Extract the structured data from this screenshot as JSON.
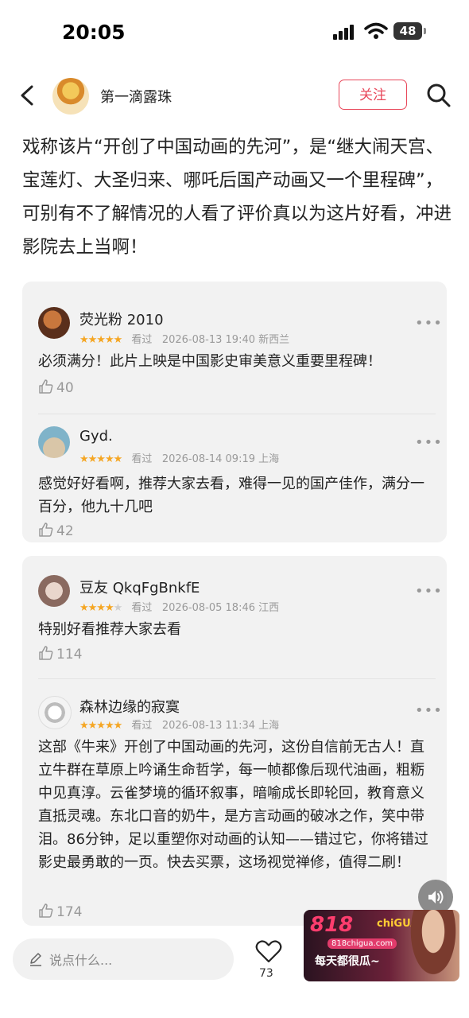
{
  "status": {
    "time": "20:05",
    "battery": "48"
  },
  "nav": {
    "author": "第一滴露珠",
    "follow": "关注"
  },
  "body_text": "戏称该片“开创了中国动画的先河”，是“继大闹天宫、宝莲灯、大圣归来、哪吒后国产动画又一个里程碑”，可别有不了解情况的人看了评价真以为这片好看，冲进影院去上当啊！",
  "comments": [
    {
      "name": "荧光粉 2010",
      "rating": 5,
      "watched": "看过",
      "time": "2026-08-13 19:40 新西兰",
      "text": "必须满分！此片上映是中国影史审美意义重要里程碑！",
      "likes": "40"
    },
    {
      "name": "Gyd.",
      "rating": 5,
      "watched": "看过",
      "time": "2026-08-14 09:19 上海",
      "text": "感觉好好看啊，推荐大家去看，难得一见的国产佳作，满分一百分，他九十几吧",
      "likes": "42"
    },
    {
      "name": "豆友 QkqFgBnkfE",
      "rating": 4,
      "watched": "看过",
      "time": "2026-08-05 18:46 江西",
      "text": "特别好看推荐大家去看",
      "likes": "114"
    },
    {
      "name": "森林边缘的寂寞",
      "rating": 5,
      "watched": "看过",
      "time": "2026-08-13 11:34 上海",
      "text": "这部《牛来》开创了中国动画的先河，这份自信前无古人！直立牛群在草原上吟诵生命哲学，每一帧都像后现代油画，粗粝中见真淳。云雀梦境的循环叙事，暗喻成长即轮回，教育意义直抵灵魂。东北口音的奶牛，是方言动画的破冰之作，笑中带泪。86分钟，足以重塑你对动画的认知——错过它，你将错过影史最勇敢的一页。快去买票，这场视觉禅修，值得二刷！",
      "likes": "174"
    }
  ],
  "more": "•••",
  "bottom": {
    "placeholder": "说点什么...",
    "likes": "73"
  },
  "ad": {
    "title": "818",
    "brand": "chiGUA",
    "url": "818chigua.com",
    "slogan": "每天都很瓜~"
  },
  "colors": {
    "accent": "#e8475a",
    "star": "#f5a623"
  }
}
